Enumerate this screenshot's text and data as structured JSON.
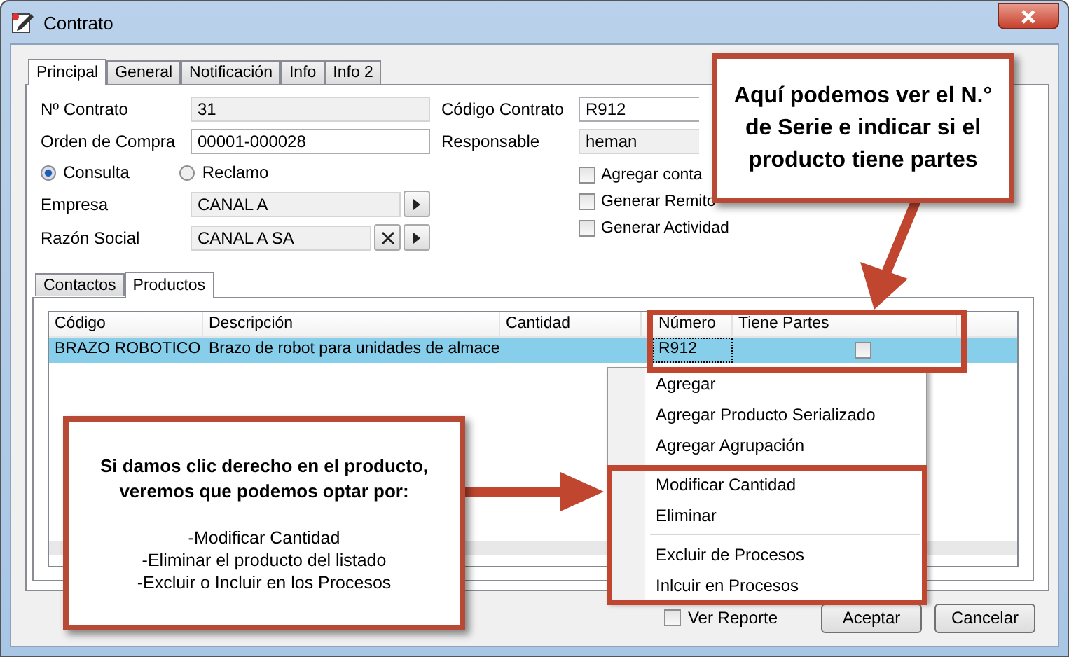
{
  "window": {
    "title": "Contrato"
  },
  "tabs": [
    {
      "label": "Principal",
      "selected": true
    },
    {
      "label": "General",
      "selected": false
    },
    {
      "label": "Notificación",
      "selected": false
    },
    {
      "label": "Info",
      "selected": false
    },
    {
      "label": "Info 2",
      "selected": false
    }
  ],
  "fields_left": [
    {
      "label": "Nº Contrato",
      "value": "31",
      "kind": "readonly"
    },
    {
      "label": "Orden de Compra",
      "value": "00001-000028",
      "kind": "input"
    }
  ],
  "fields_right": [
    {
      "label": "Código Contrato",
      "value": "R912",
      "kind": "input"
    },
    {
      "label": "Responsable",
      "value": "heman",
      "kind": "readonly"
    }
  ],
  "radios": [
    {
      "label": "Consulta",
      "selected": true
    },
    {
      "label": "Reclamo",
      "selected": false
    }
  ],
  "lookups": [
    {
      "label": "Empresa",
      "value": "CANAL A",
      "clearable": false
    },
    {
      "label": "Razón Social",
      "value": "CANAL A SA",
      "clearable": true
    }
  ],
  "checkboxes": [
    {
      "label": "Agregar conta",
      "checked": false
    },
    {
      "label": "Generar Remito",
      "checked": false
    },
    {
      "label": "Generar Actividad",
      "checked": false
    }
  ],
  "sub_tabs": [
    {
      "label": "Contactos",
      "selected": false
    },
    {
      "label": "Productos",
      "selected": true
    }
  ],
  "grid": {
    "columns": [
      "Código",
      "Descripción",
      "Cantidad",
      "Número",
      "Tiene Partes"
    ],
    "rows": [
      {
        "codigo": "BRAZO ROBOTICO",
        "descripcion": "Brazo de robot para unidades de almace",
        "numero": "R912",
        "tiene_partes": false,
        "selected": true
      }
    ]
  },
  "context_menu": {
    "groups": [
      [
        "Agregar",
        "Agregar Producto Serializado",
        "Agregar Agrupación"
      ],
      [
        "Modificar Cantidad",
        "Eliminar"
      ],
      [
        "Excluir de Procesos",
        "Inlcuir en Procesos"
      ]
    ]
  },
  "ver_reporte": {
    "label": "Ver Reporte",
    "checked": false
  },
  "buttons": [
    "Aceptar",
    "Cancelar"
  ],
  "callouts": [
    {
      "kind": "heading",
      "heading": "Aquí podemos ver el N.° de Serie e indicar si el producto tiene partes"
    },
    {
      "kind": "list",
      "heading": "Si damos clic derecho en el producto, veremos que podemos optar por:",
      "lines": [
        "-Modificar Cantidad",
        "-Eliminar el producto del listado",
        "-Excluir o Incluir en los Procesos"
      ]
    }
  ]
}
